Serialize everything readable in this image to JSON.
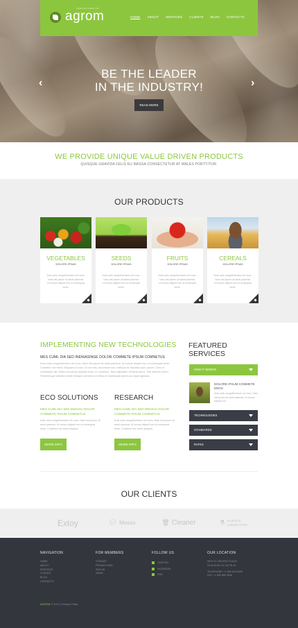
{
  "header": {
    "logo_text": "agrom",
    "logo_tagline": "AGRICULTURAL CO.",
    "nav": [
      "HOME",
      "ABOUT",
      "SERVICES",
      "CLIENTS",
      "BLOG",
      "CONTACTS"
    ]
  },
  "hero": {
    "title_line1": "BE THE LEADER",
    "title_line2": "IN THE INDUSTRY!",
    "button": "READ MORE",
    "prev": "‹",
    "next": "›"
  },
  "value": {
    "title": "WE PROVIDE UNIQUE VALUE DRIVEN PRODUCTS",
    "subtitle": "QUISQUE GRAVIDA FELIS EU MASSA CONSECTETUR AT MALES PORTTITOR."
  },
  "products": {
    "title": "OUR PRODUCTS",
    "items": [
      {
        "title": "VEGETABLES",
        "sub": "DOLORE IPSUM",
        "text": "Duis nulis congultmentum vel nunc. Nam nisi ipsum sit amet placerat. Ut cursus aliquet non ut consequat tortor."
      },
      {
        "title": "SEEDS",
        "sub": "DOLORE IPSUM",
        "text": "Duis nulis congultmentum vel nunc. Nam nisi ipsum sit amet placerat. Ut cursus aliquet non ut consequat tortor."
      },
      {
        "title": "FRUITS",
        "sub": "DOLORE IPSUM",
        "text": "Duis nulis congultmentum vel nunc. Nam nisi ipsum sit amet placerat. Ut cursus aliquet non ut consequat tortor."
      },
      {
        "title": "CEREALS",
        "sub": "DOLORE IPSUM",
        "text": "Duis nulis congultmentum vel nunc. Nam nisi ipsum sit amet placerat. Ut cursus aliquet non ut consequat tortor."
      }
    ]
  },
  "tech": {
    "title": "IMPLEMENTING NEW TECHNOLOGIES",
    "sub": "MES CUML DIA SED INENIASINGE DOLOR COMMETE IPSUM COMNETUS",
    "text": "Duis nulis congultmentum vel nunc. Nam nisi ipsum sit amet placerat. Ut cursus aliquet non ut consequat tortor. Curabitur nec tortor. Aliquam ut nunc. Ut orci nisl, accumsan non, tristique at, faucibus quis, ipsum. Cras ut consequat nisi. Etiam nonummy aliquam enim, in a pretium. Nam dignissim vehicula lacus. Sed ultricies lorem. Pellentesque habitant morbi tristique senectus et netus et malesuada fames ac turpis egestas."
  },
  "eco": {
    "title": "ECO SOLUTIONS",
    "sub": "MES CUML DIA SED INENIAV DOLOR COMMETE IPSUM COMNETUS",
    "text": "Duis nulis congultmentum vel nunc. Nam nisi ipsum sit amet placerat. Ut cursus aliquet non ut consequat tortor. Curabitur nec tortor aliquam.",
    "button": "MORE INFO"
  },
  "research": {
    "title": "RESEARCH",
    "sub": "MES CUML DIA SED INENIAS DOLOR COMMETE IPSUM COMNETUS",
    "text": "Duis nulis congultmentum vel nunc. Nam nisi ipsum sit amet placerat. Ut cursus aliquet non ut consequat tortor. Curabitur nec tortor aliquam.",
    "button": "MORE INFO"
  },
  "featured": {
    "title_line1": "FEATURED",
    "title_line2": "SERVICES",
    "accordion": [
      "HOW IT WORKS",
      "TECHNOLOGIES",
      "STANDARDS",
      "RATES"
    ],
    "item_head": "DOLORE IPSUM COMMETE EROS",
    "item_text": "Duis nulis congultmentum vel nunc. Nam nisi ipsum sit amet placerat. Ut cursus aliquet non."
  },
  "clients": {
    "title": "OUR CLIENTS",
    "items": [
      "Extoy",
      "Messo",
      "Cleaner",
      "SCIENCE LABORATORY"
    ]
  },
  "footer": {
    "nav_head": "NAVIGATION",
    "nav_links": [
      "HOME",
      "ABOUT",
      "SERVICES",
      "CLIENTS",
      "BLOG",
      "CONTACTS"
    ],
    "members_head": "FOR MEMBERS",
    "members_links": [
      "FORUMS",
      "PROMOTIONS",
      "SIGN IN",
      "NEWS"
    ],
    "follow_head": "FOLLOW US",
    "follow_links": [
      "TWITTER",
      "FACEBOOK",
      "RSS"
    ],
    "location_head": "OUR LOCATION",
    "location_lines": [
      "9870 ST VINCENT PLACE,",
      "GLASGOW, DC 45 FR 45",
      "",
      "TELEPHONE: +1 800 603 6035",
      "FAX: +1 800 889 9898"
    ],
    "copy_brand": "AGROM",
    "copy_rest": "© 2014 | Privacy Policy"
  },
  "colors": {
    "accent": "#8cc63f",
    "dark": "#34363d"
  }
}
